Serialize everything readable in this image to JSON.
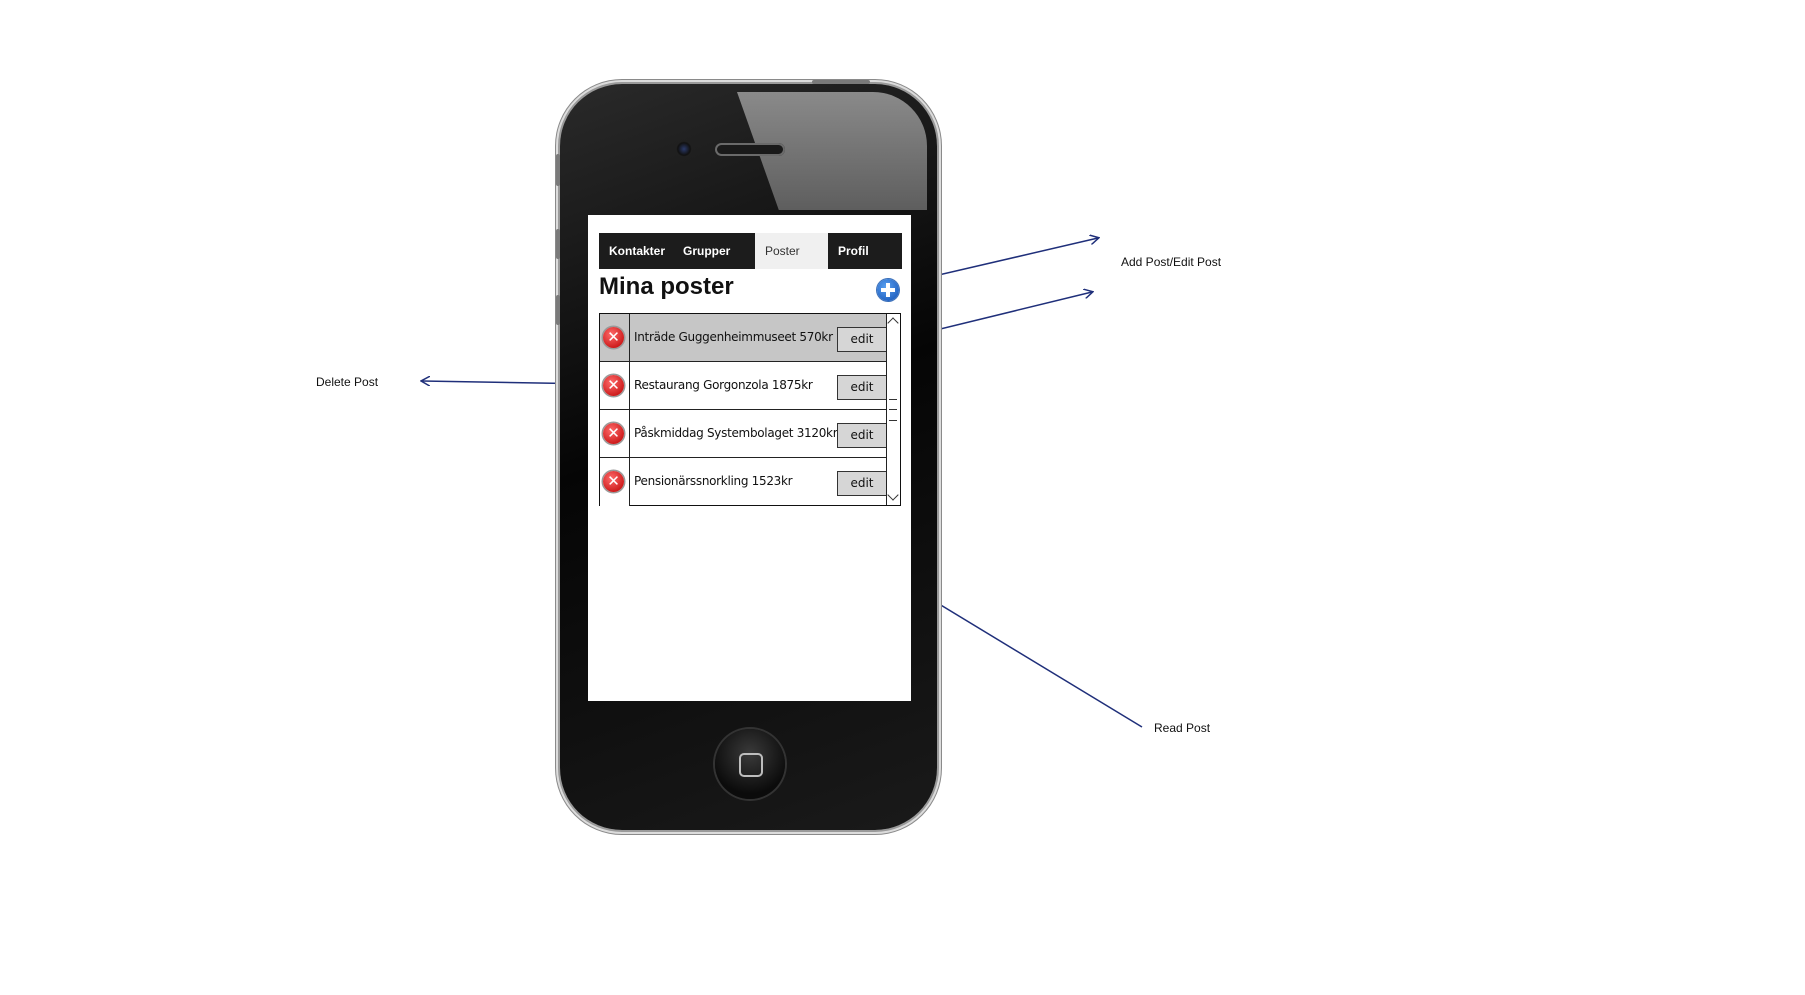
{
  "tabs": [
    {
      "label": "Kontakter",
      "active": false
    },
    {
      "label": "Grupper",
      "active": false
    },
    {
      "label": "Poster",
      "active": true
    },
    {
      "label": "Profil",
      "active": false
    }
  ],
  "screen_title": "Mina poster",
  "posts": [
    {
      "text": "Inträde Guggenheimmuseet 570kr",
      "edit_label": "edit",
      "selected": true
    },
    {
      "text": "Restaurang Gorgonzola 1875kr",
      "edit_label": "edit",
      "selected": false
    },
    {
      "text": "Påskmiddag Systembolaget 3120kr",
      "edit_label": "edit",
      "selected": false
    },
    {
      "text": "Pensionärssnorkling 1523kr",
      "edit_label": "edit",
      "selected": false
    }
  ],
  "icons": {
    "add": "plus-circle-icon",
    "delete": "x-circle-icon"
  },
  "annotations": {
    "add_edit": "Add Post/Edit Post",
    "delete": "Delete Post",
    "read": "Read Post"
  },
  "colors": {
    "arrow": "#1f2f7a",
    "selected_row": "#c6c6c6",
    "tab_dark": "#1c1c1c"
  }
}
